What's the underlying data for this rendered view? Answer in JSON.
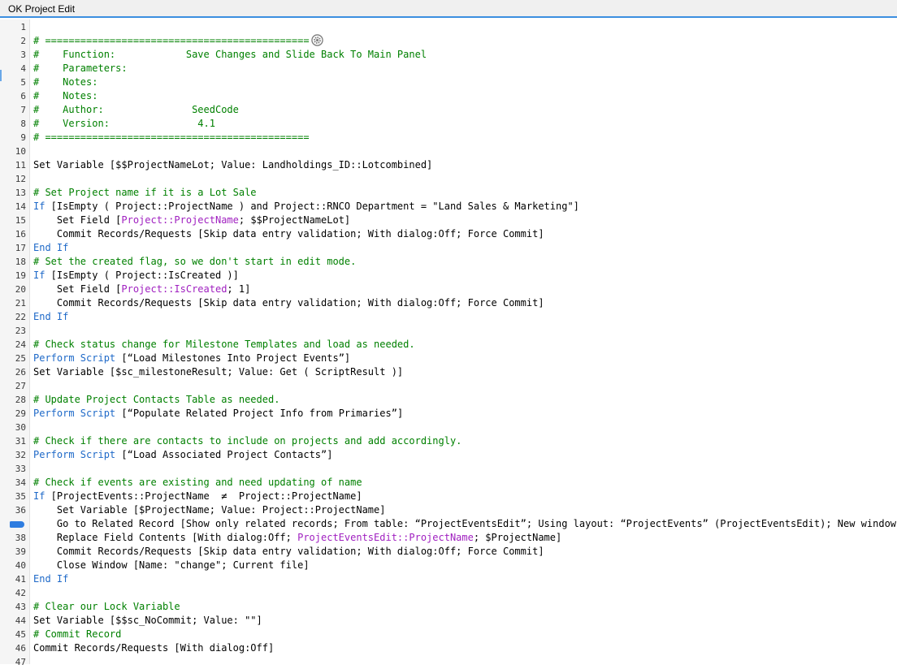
{
  "window": {
    "title": "OK Project Edit"
  },
  "lines": [
    {
      "n": "1",
      "segs": []
    },
    {
      "n": "2",
      "segs": [
        {
          "t": "# =============================================",
          "c": "cmt"
        }
      ],
      "icon": "gear-icon"
    },
    {
      "n": "3",
      "segs": [
        {
          "t": "#    Function:            Save Changes and Slide Back To Main Panel",
          "c": "cmt"
        }
      ]
    },
    {
      "n": "4",
      "segs": [
        {
          "t": "#    Parameters:",
          "c": "cmt"
        }
      ]
    },
    {
      "n": "5",
      "segs": [
        {
          "t": "#    Notes:",
          "c": "cmt"
        }
      ]
    },
    {
      "n": "6",
      "segs": [
        {
          "t": "#    Notes:",
          "c": "cmt"
        }
      ]
    },
    {
      "n": "7",
      "segs": [
        {
          "t": "#    Author:               SeedCode",
          "c": "cmt"
        }
      ]
    },
    {
      "n": "8",
      "segs": [
        {
          "t": "#    Version:               4.1",
          "c": "cmt"
        }
      ]
    },
    {
      "n": "9",
      "segs": [
        {
          "t": "# =============================================",
          "c": "cmt"
        }
      ]
    },
    {
      "n": "10",
      "segs": []
    },
    {
      "n": "11",
      "segs": [
        {
          "t": "Set Variable [$$ProjectNameLot; Value: Landholdings_ID::Lotcombined]",
          "c": ""
        }
      ]
    },
    {
      "n": "12",
      "segs": []
    },
    {
      "n": "13",
      "segs": [
        {
          "t": "# Set Project name if it is a Lot Sale",
          "c": "cmt"
        }
      ]
    },
    {
      "n": "14",
      "segs": [
        {
          "t": "If",
          "c": "kw"
        },
        {
          "t": " [IsEmpty ( Project::ProjectName ) and Project::RNCO Department = \"Land Sales & Marketing\"]",
          "c": ""
        }
      ]
    },
    {
      "n": "15",
      "segs": [
        {
          "t": "    Set Field [",
          "c": ""
        },
        {
          "t": "Project::ProjectName",
          "c": "fld"
        },
        {
          "t": "; $$ProjectNameLot]",
          "c": ""
        }
      ]
    },
    {
      "n": "16",
      "segs": [
        {
          "t": "    Commit Records/Requests [Skip data entry validation; With dialog:Off; Force Commit]",
          "c": ""
        }
      ]
    },
    {
      "n": "17",
      "segs": [
        {
          "t": "End If",
          "c": "kw"
        }
      ]
    },
    {
      "n": "18",
      "segs": [
        {
          "t": "# Set the created flag, so we don't start in edit mode.",
          "c": "cmt"
        }
      ]
    },
    {
      "n": "19",
      "segs": [
        {
          "t": "If",
          "c": "kw"
        },
        {
          "t": " [IsEmpty ( Project::IsCreated )]",
          "c": ""
        }
      ]
    },
    {
      "n": "20",
      "segs": [
        {
          "t": "    Set Field [",
          "c": ""
        },
        {
          "t": "Project::IsCreated",
          "c": "fld"
        },
        {
          "t": "; 1]",
          "c": ""
        }
      ]
    },
    {
      "n": "21",
      "segs": [
        {
          "t": "    Commit Records/Requests [Skip data entry validation; With dialog:Off; Force Commit]",
          "c": ""
        }
      ]
    },
    {
      "n": "22",
      "segs": [
        {
          "t": "End If",
          "c": "kw"
        }
      ]
    },
    {
      "n": "23",
      "segs": []
    },
    {
      "n": "24",
      "segs": [
        {
          "t": "# Check status change for Milestone Templates and load as needed.",
          "c": "cmt"
        }
      ]
    },
    {
      "n": "25",
      "segs": [
        {
          "t": "Perform Script",
          "c": "kw"
        },
        {
          "t": " [“Load Milestones Into Project Events”]",
          "c": ""
        }
      ]
    },
    {
      "n": "26",
      "segs": [
        {
          "t": "Set Variable [$sc_milestoneResult; Value: Get ( ScriptResult )]",
          "c": ""
        }
      ]
    },
    {
      "n": "27",
      "segs": []
    },
    {
      "n": "28",
      "segs": [
        {
          "t": "# Update Project Contacts Table as needed.",
          "c": "cmt"
        }
      ]
    },
    {
      "n": "29",
      "segs": [
        {
          "t": "Perform Script",
          "c": "kw"
        },
        {
          "t": " [“Populate Related Project Info from Primaries”]",
          "c": ""
        }
      ]
    },
    {
      "n": "30",
      "segs": []
    },
    {
      "n": "31",
      "segs": [
        {
          "t": "# Check if there are contacts to include on projects and add accordingly.",
          "c": "cmt"
        }
      ]
    },
    {
      "n": "32",
      "segs": [
        {
          "t": "Perform Script",
          "c": "kw"
        },
        {
          "t": " [“Load Associated Project Contacts”]",
          "c": ""
        }
      ]
    },
    {
      "n": "33",
      "segs": []
    },
    {
      "n": "34",
      "segs": [
        {
          "t": "# Check if events are existing and need updating of name",
          "c": "cmt"
        }
      ]
    },
    {
      "n": "35",
      "segs": [
        {
          "t": "If",
          "c": "kw"
        },
        {
          "t": " [ProjectEvents::ProjectName  ≠  Project::ProjectName]",
          "c": ""
        }
      ]
    },
    {
      "n": "36",
      "segs": [
        {
          "t": "    Set Variable [$ProjectName; Value: Project::ProjectName]",
          "c": ""
        }
      ]
    },
    {
      "n": "37",
      "segs": [
        {
          "t": "    Go to Related Record [Show only related records; From table: “ProjectEventsEdit”; Using layout: “ProjectEvents” (ProjectEventsEdit); New window]",
          "c": ""
        }
      ],
      "breakpoint": true,
      "hideNum": true
    },
    {
      "n": "38",
      "segs": [
        {
          "t": "    Replace Field Contents [With dialog:Off; ",
          "c": ""
        },
        {
          "t": "ProjectEventsEdit::ProjectName",
          "c": "fld"
        },
        {
          "t": "; $ProjectName]",
          "c": ""
        }
      ]
    },
    {
      "n": "39",
      "segs": [
        {
          "t": "    Commit Records/Requests [Skip data entry validation; With dialog:Off; Force Commit]",
          "c": ""
        }
      ]
    },
    {
      "n": "40",
      "segs": [
        {
          "t": "    Close Window [Name: \"change\"; Current file]",
          "c": ""
        }
      ]
    },
    {
      "n": "41",
      "segs": [
        {
          "t": "End If",
          "c": "kw"
        }
      ]
    },
    {
      "n": "42",
      "segs": []
    },
    {
      "n": "43",
      "segs": [
        {
          "t": "# Clear our Lock Variable",
          "c": "cmt"
        }
      ]
    },
    {
      "n": "44",
      "segs": [
        {
          "t": "Set Variable [$$sc_NoCommit; Value: \"\"]",
          "c": ""
        }
      ]
    },
    {
      "n": "45",
      "segs": [
        {
          "t": "# Commit Record",
          "c": "cmt"
        }
      ]
    },
    {
      "n": "46",
      "segs": [
        {
          "t": "Commit Records/Requests [With dialog:Off]",
          "c": ""
        }
      ]
    },
    {
      "n": "47",
      "segs": []
    }
  ]
}
